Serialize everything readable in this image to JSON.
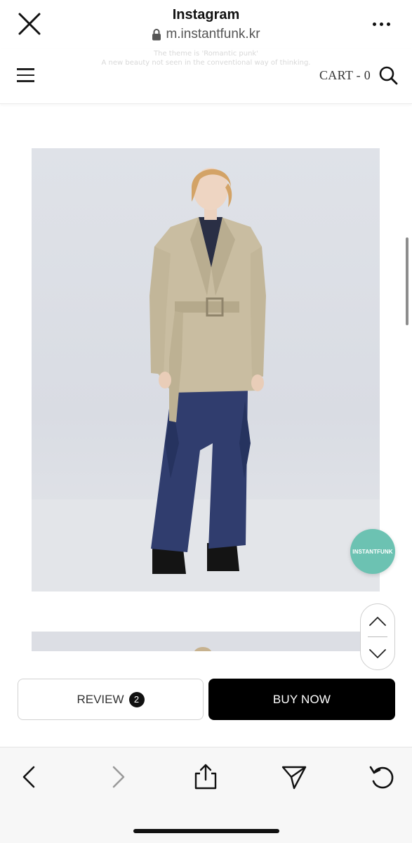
{
  "browser": {
    "title": "Instagram",
    "url": "m.instantfunk.kr",
    "close_icon": "close-icon",
    "lock_icon": "lock-icon",
    "more_icon": "more-horizontal-icon"
  },
  "notice": {
    "line1": "The theme is 'Romantic punk'",
    "line2": "A new beauty not seen in the conventional way of thinking."
  },
  "nav": {
    "menu_icon": "hamburger-menu-icon",
    "cart_label": "CART - 0",
    "search_icon": "search-icon"
  },
  "floating": {
    "brand_badge": "INSTANTFUNK",
    "badge_color": "#6cc2b2",
    "scroll_up_icon": "chevron-up-icon",
    "scroll_down_icon": "chevron-down-icon"
  },
  "actions": {
    "review_label": "REVIEW",
    "review_count": "2",
    "buy_label": "BUY NOW",
    "buy_color": "#000000"
  },
  "toolbar": {
    "icons": [
      "back-arrow-icon",
      "forward-arrow-icon",
      "share-icon",
      "send-icon",
      "reload-icon"
    ]
  }
}
